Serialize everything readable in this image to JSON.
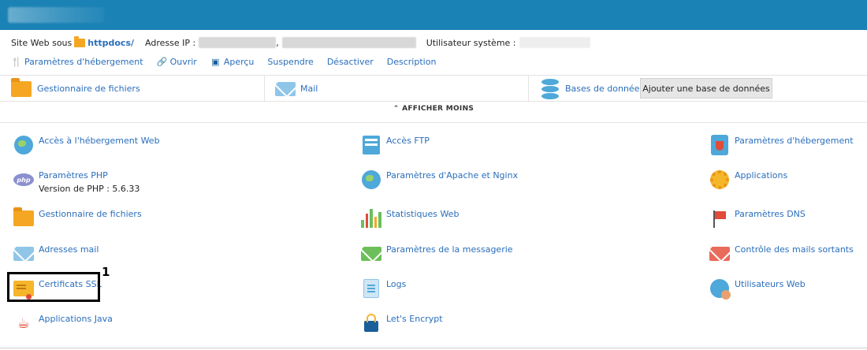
{
  "site": {
    "prefix": "Site Web sous",
    "docroot": "httpdocs/",
    "ip_label": "Adresse IP :",
    "ip_sep": ",",
    "user_label": "Utilisateur système :"
  },
  "actions": [
    {
      "label": "Paramètres d'hébergement",
      "icon": "hosting-settings-icon",
      "glyph": "🍴"
    },
    {
      "label": "Ouvrir",
      "icon": "open-icon",
      "glyph": "🔗"
    },
    {
      "label": "Aperçu",
      "icon": "preview-icon",
      "glyph": "▣"
    },
    {
      "label": "Suspendre",
      "icon": "",
      "glyph": ""
    },
    {
      "label": "Désactiver",
      "icon": "",
      "glyph": ""
    },
    {
      "label": "Description",
      "icon": "",
      "glyph": ""
    }
  ],
  "panels": {
    "file_manager": "Gestionnaire de fichiers",
    "mail": "Mail",
    "databases": "Bases de données",
    "add_database": "Ajouter une base de données"
  },
  "show_less": "AFFICHER MOINS",
  "tools": {
    "col1": [
      {
        "label": "Accès à l'hébergement Web"
      },
      {
        "label": "Paramètres PHP",
        "sub": "Version de PHP : 5.6.33"
      },
      {
        "label": "Gestionnaire de fichiers"
      },
      {
        "label": "Adresses mail"
      },
      {
        "label": "Certificats SSL"
      },
      {
        "label": "Applications Java"
      }
    ],
    "col2": [
      {
        "label": "Accès FTP"
      },
      {
        "label": "Paramètres d'Apache et Nginx"
      },
      {
        "label": "Statistiques Web"
      },
      {
        "label": "Paramètres de la messagerie"
      },
      {
        "label": "Logs"
      },
      {
        "label": "Let's Encrypt"
      }
    ],
    "col3": [
      {
        "label": "Paramètres d'hébergement"
      },
      {
        "label": "Applications"
      },
      {
        "label": "Paramètres DNS"
      },
      {
        "label": "Contrôle des mails sortants"
      },
      {
        "label": "Utilisateurs Web"
      }
    ]
  },
  "annotation": {
    "number": "1"
  }
}
